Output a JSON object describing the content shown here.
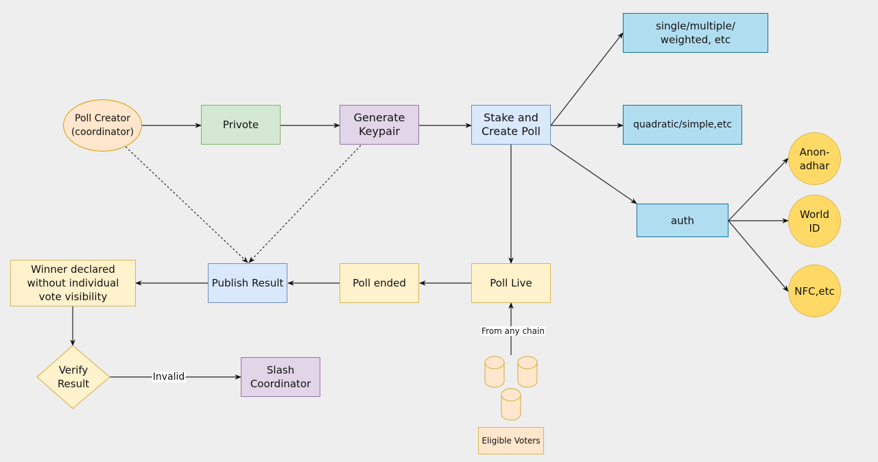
{
  "diagram": {
    "title": "",
    "nodes": {
      "poll_creator": "Poll Creator\n(coordinator)",
      "privote": "Privote",
      "generate_keypair": "Generate\nKeypair",
      "stake_create_poll": "Stake and\nCreate Poll",
      "single_multiple": "single/multiple/\nweighted, etc",
      "quadratic_simple": "quadratic/simple,etc",
      "auth": "auth",
      "anon_adhar": "Anon-\nadhar",
      "world_id": "World\nID",
      "nfc_etc": "NFC,etc",
      "poll_live": "Poll Live",
      "poll_ended": "Poll ended",
      "publish_result": "Publish Result",
      "winner_declared": "Winner declared\nwithout individual\nvote visibility",
      "verify_result": "Verify\nResult",
      "slash_coordinator": "Slash\nCoordinator",
      "eligible_voters": "Eligible Voters"
    },
    "edge_labels": {
      "from_any_chain": "From any chain",
      "invalid": "Invalid"
    },
    "edges": [
      {
        "from": "poll_creator",
        "to": "privote",
        "style": "solid"
      },
      {
        "from": "privote",
        "to": "generate_keypair",
        "style": "solid"
      },
      {
        "from": "generate_keypair",
        "to": "stake_create_poll",
        "style": "solid"
      },
      {
        "from": "stake_create_poll",
        "to": "single_multiple",
        "style": "solid"
      },
      {
        "from": "stake_create_poll",
        "to": "quadratic_simple",
        "style": "solid"
      },
      {
        "from": "stake_create_poll",
        "to": "auth",
        "style": "solid"
      },
      {
        "from": "auth",
        "to": "anon_adhar",
        "style": "solid"
      },
      {
        "from": "auth",
        "to": "world_id",
        "style": "solid"
      },
      {
        "from": "auth",
        "to": "nfc_etc",
        "style": "solid"
      },
      {
        "from": "stake_create_poll",
        "to": "poll_live",
        "style": "solid"
      },
      {
        "from": "eligible_voters",
        "to": "poll_live",
        "style": "solid",
        "label": "From any chain"
      },
      {
        "from": "poll_live",
        "to": "poll_ended",
        "style": "solid"
      },
      {
        "from": "poll_ended",
        "to": "publish_result",
        "style": "solid"
      },
      {
        "from": "poll_creator",
        "to": "publish_result",
        "style": "dotted"
      },
      {
        "from": "generate_keypair",
        "to": "publish_result",
        "style": "dotted"
      },
      {
        "from": "publish_result",
        "to": "winner_declared",
        "style": "solid"
      },
      {
        "from": "winner_declared",
        "to": "verify_result",
        "style": "solid"
      },
      {
        "from": "verify_result",
        "to": "slash_coordinator",
        "style": "solid",
        "label": "Invalid"
      }
    ],
    "colors": {
      "background": "#eeeeee",
      "green": "#d5e8d4",
      "purple": "#e1d5e7",
      "blue": "#dae8fc",
      "cyan": "#b1ddf0",
      "yellow": "#fff2cc",
      "orange": "#ffe6cc",
      "gold": "#ffd966"
    }
  }
}
